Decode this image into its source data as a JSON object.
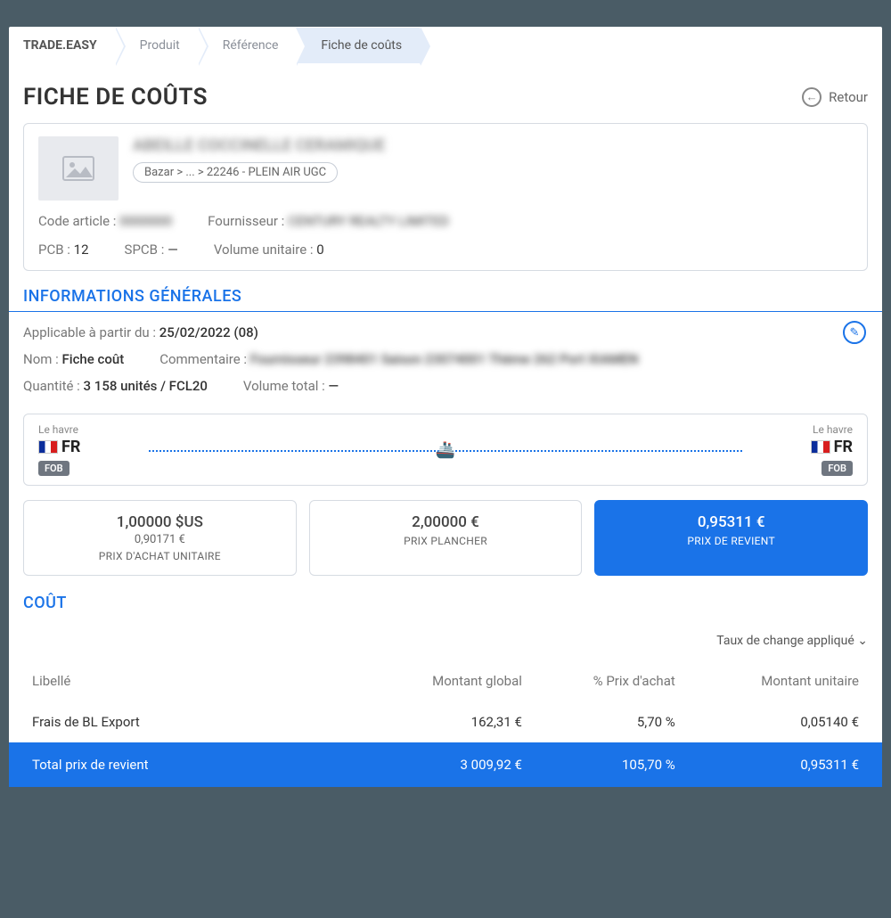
{
  "breadcrumb": {
    "root": "TRADE.EASY",
    "level1": "Produit",
    "level2": "Référence",
    "current": "Fiche de coûts"
  },
  "header": {
    "title": "FICHE DE COÛTS",
    "back": "Retour"
  },
  "product": {
    "title_blur": "ABEILLE COCCINELLE CERAMIQUE",
    "category": "Bazar > ... > 22246 - PLEIN AIR UGC",
    "code_label": "Code article :",
    "code_value": "0000000",
    "supplier_label": "Fournisseur :",
    "supplier_value": "CENTURY REALTY LIMITED",
    "pcb_label": "PCB :",
    "pcb_value": "12",
    "spcb_label": "SPCB :",
    "spcb_value": "—",
    "volunit_label": "Volume unitaire :",
    "volunit_value": "0"
  },
  "section_info": "INFORMATIONS GÉNÉRALES",
  "info": {
    "applicable_label": "Applicable à partir du :",
    "applicable_value": "25/02/2022 (08)",
    "name_label": "Nom :",
    "name_value": "Fiche coût",
    "comment_label": "Commentaire :",
    "comment_value": "Fournisseur 2398401 Saison 23074001 Thème 262 Port XIAMEN",
    "qty_label": "Quantité :",
    "qty_value": "3 158 unités / FCL20",
    "voltot_label": "Volume total :",
    "voltot_value": "—"
  },
  "route": {
    "origin_city": "Le havre",
    "origin_country": "FR",
    "origin_term": "FOB",
    "dest_city": "Le havre",
    "dest_country": "FR",
    "dest_term": "FOB"
  },
  "tiles": {
    "t1_main": "1,00000 $US",
    "t1_sub": "0,90171 €",
    "t1_cap": "PRIX D'ACHAT UNITAIRE",
    "t2_main": "2,00000 €",
    "t2_cap": "PRIX PLANCHER",
    "t3_main": "0,95311 €",
    "t3_cap": "PRIX DE REVIENT"
  },
  "section_cost": "COÛT",
  "cost": {
    "rate_toggle": "Taux de change appliqué",
    "col_label": "Libellé",
    "col_global": "Montant global",
    "col_pct": "% Prix d'achat",
    "col_unit": "Montant unitaire",
    "row_label": "Frais de BL Export",
    "row_global": "162,31 €",
    "row_pct": "5,70 %",
    "row_unit": "0,05140 €",
    "total_label": "Total prix de revient",
    "total_global": "3 009,92 €",
    "total_pct": "105,70 %",
    "total_unit": "0,95311 €"
  }
}
